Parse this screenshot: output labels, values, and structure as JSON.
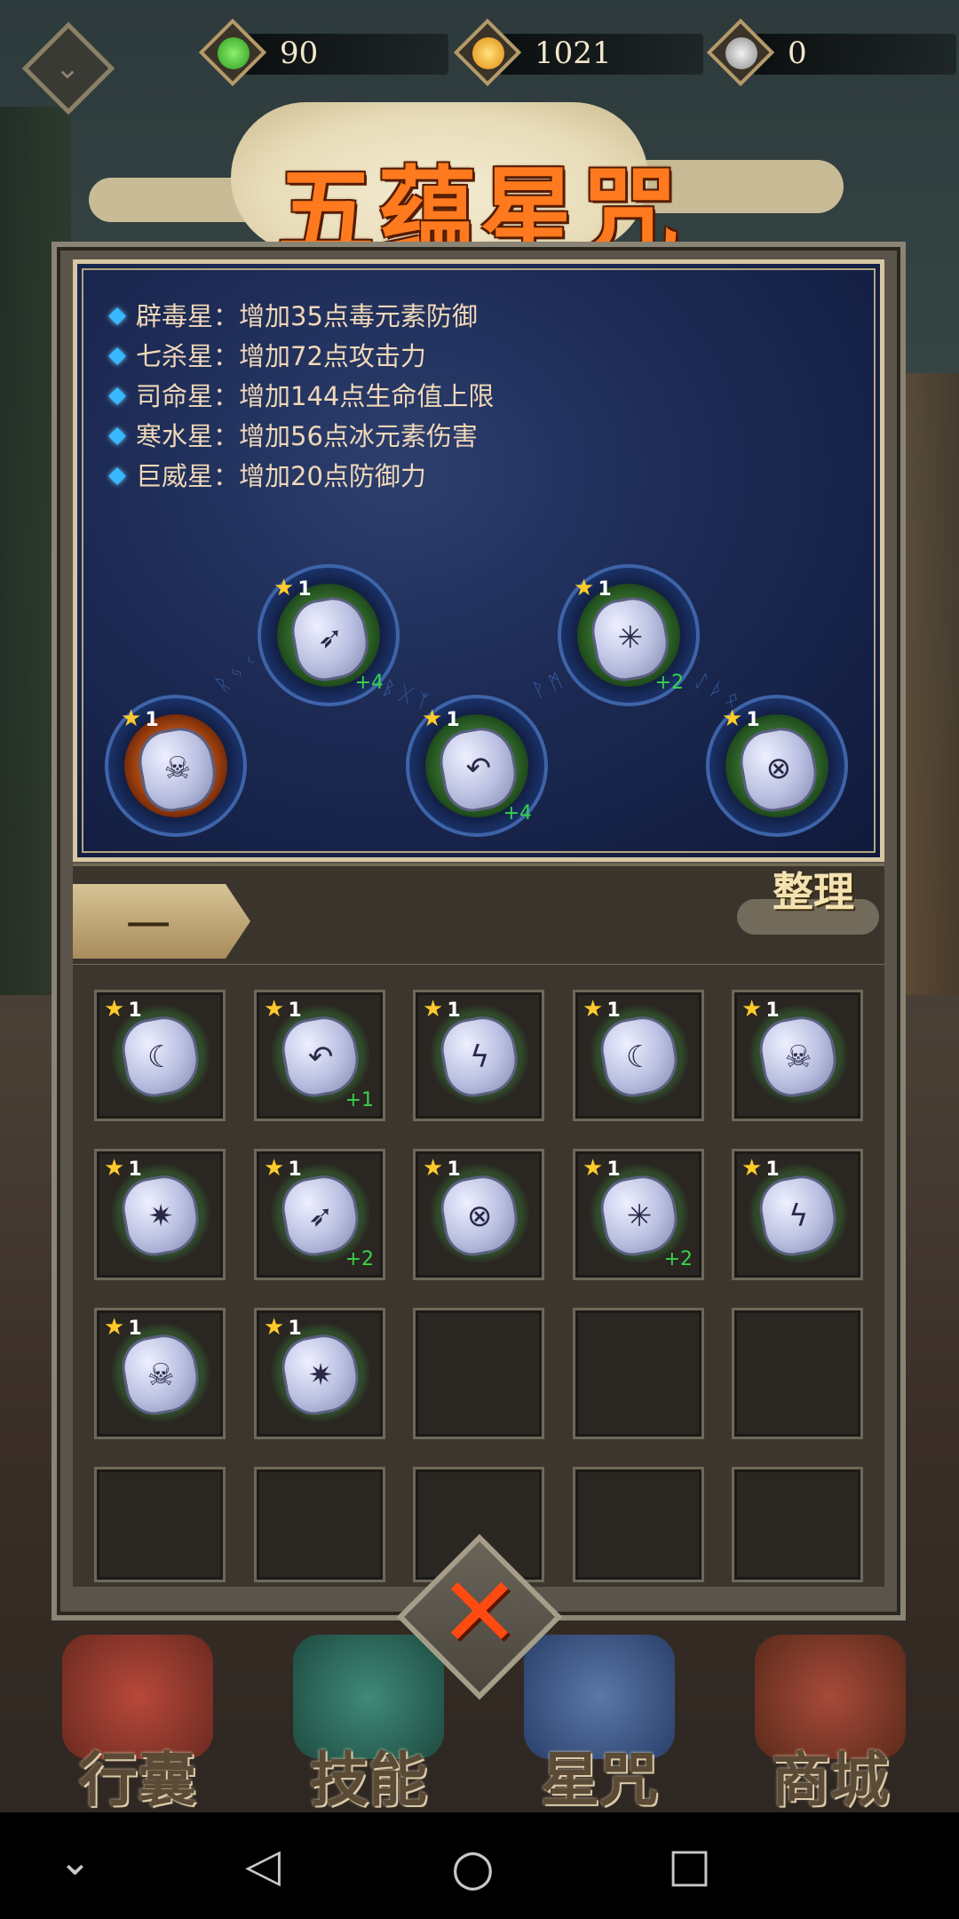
{
  "resources": [
    {
      "icon": "water-drop-icon",
      "value": "90",
      "color": "#3fbf3a"
    },
    {
      "icon": "gold-coin-icon",
      "value": "1021",
      "color": "#f5a21a"
    },
    {
      "icon": "yin-yang-icon",
      "value": "0",
      "color": "#bfbfbf"
    }
  ],
  "title": "五蕴星咒",
  "bonuses": [
    "辟毒星：增加35点毒元素防御",
    "七杀星：增加72点攻击力",
    "司命星：增加144点生命值上限",
    "寒水星：增加56点冰元素伤害",
    "巨威星：增加20点防御力"
  ],
  "equipped": [
    {
      "glyph": "☠",
      "stars": "1",
      "plus": "",
      "ring": "#c45a1c"
    },
    {
      "glyph": "➶",
      "stars": "1",
      "plus": "+4",
      "ring": "#3d7a34"
    },
    {
      "glyph": "↶",
      "stars": "1",
      "plus": "+4",
      "ring": "#3d7a34"
    },
    {
      "glyph": "✳",
      "stars": "1",
      "plus": "+2",
      "ring": "#3d7a34"
    },
    {
      "glyph": "⊗",
      "stars": "1",
      "plus": "",
      "ring": "#3d7a34"
    }
  ],
  "tab_label": "一",
  "sort_label": "整理",
  "inventory": [
    {
      "glyph": "☾",
      "stars": "1",
      "plus": ""
    },
    {
      "glyph": "↶",
      "stars": "1",
      "plus": "+1"
    },
    {
      "glyph": "ϟ",
      "stars": "1",
      "plus": ""
    },
    {
      "glyph": "☾",
      "stars": "1",
      "plus": ""
    },
    {
      "glyph": "☠",
      "stars": "1",
      "plus": ""
    },
    {
      "glyph": "✷",
      "stars": "1",
      "plus": ""
    },
    {
      "glyph": "➶",
      "stars": "1",
      "plus": "+2"
    },
    {
      "glyph": "⊗",
      "stars": "1",
      "plus": ""
    },
    {
      "glyph": "✳",
      "stars": "1",
      "plus": "+2"
    },
    {
      "glyph": "ϟ",
      "stars": "1",
      "plus": ""
    },
    {
      "glyph": "☠",
      "stars": "1",
      "plus": ""
    },
    {
      "glyph": "✷",
      "stars": "1",
      "plus": ""
    }
  ],
  "nav": [
    "行囊",
    "技能",
    "星咒",
    "商城"
  ],
  "close_icon": "close-x-icon"
}
